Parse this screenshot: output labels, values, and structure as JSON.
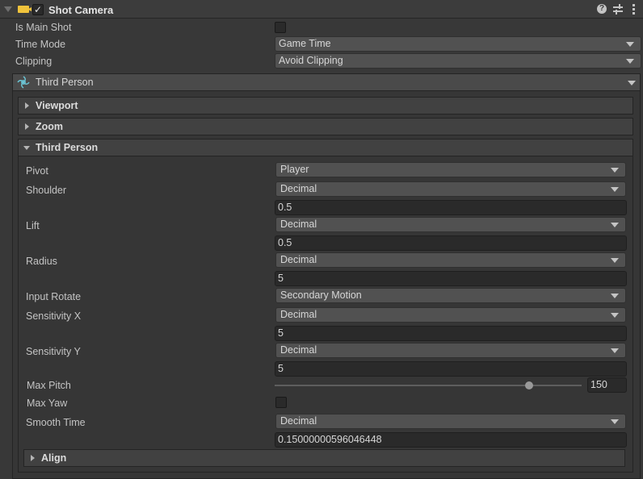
{
  "component": {
    "title": "Shot Camera",
    "enabled": true,
    "icons": [
      "help-icon",
      "presets-icon",
      "more-icon"
    ]
  },
  "top_fields": [
    {
      "label": "Is Main Shot",
      "type": "checkbox",
      "checked": false
    },
    {
      "label": "Time Mode",
      "type": "dropdown",
      "value": "Game Time"
    },
    {
      "label": "Clipping",
      "type": "dropdown",
      "value": "Avoid Clipping"
    }
  ],
  "shot_type": {
    "label": "Third Person",
    "icon_color": "#6cc8d8"
  },
  "sections": {
    "viewport": "Viewport",
    "zoom": "Zoom",
    "third_person": "Third Person",
    "align": "Align"
  },
  "third_person": {
    "pivot": {
      "label": "Pivot",
      "value": "Player"
    },
    "shoulder": {
      "label": "Shoulder",
      "mode": "Decimal",
      "value": "0.5"
    },
    "lift": {
      "label": "Lift",
      "mode": "Decimal",
      "value": "0.5"
    },
    "radius": {
      "label": "Radius",
      "mode": "Decimal",
      "value": "5"
    },
    "input_rotate": {
      "label": "Input Rotate",
      "value": "Secondary Motion"
    },
    "sensitivity_x": {
      "label": "Sensitivity X",
      "mode": "Decimal",
      "value": "5"
    },
    "sensitivity_y": {
      "label": "Sensitivity Y",
      "mode": "Decimal",
      "value": "5"
    },
    "max_pitch": {
      "label": "Max Pitch",
      "value": "150",
      "slider_fraction": 0.83
    },
    "max_yaw": {
      "label": "Max Yaw",
      "checked": false
    },
    "smooth_time": {
      "label": "Smooth Time",
      "mode": "Decimal",
      "value": "0.15000000596046448"
    }
  }
}
